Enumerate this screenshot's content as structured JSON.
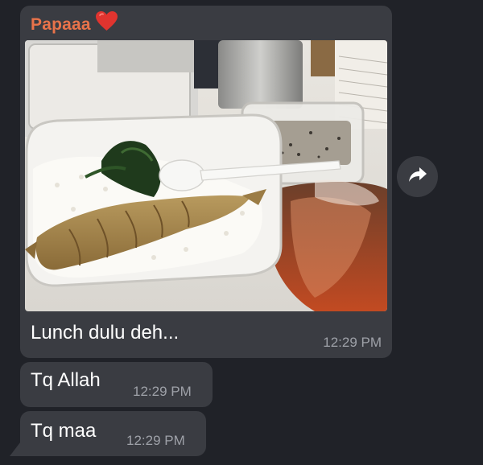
{
  "chat": {
    "photo_message": {
      "sender": "Papaaa",
      "sender_emoji": "red-heart-icon",
      "caption": "Lunch dulu deh...",
      "time": "12:29 PM"
    },
    "messages": [
      {
        "text": "Tq Allah",
        "time": "12:29 PM"
      },
      {
        "text": "Tq maa",
        "time": "12:29 PM"
      }
    ],
    "forward_button_icon": "forward-arrow-icon"
  },
  "colors": {
    "background": "#202228",
    "bubble": "#3a3c42",
    "sender_name": "#e8734a",
    "timestamp": "#9ea1a8",
    "text": "#ffffff"
  }
}
